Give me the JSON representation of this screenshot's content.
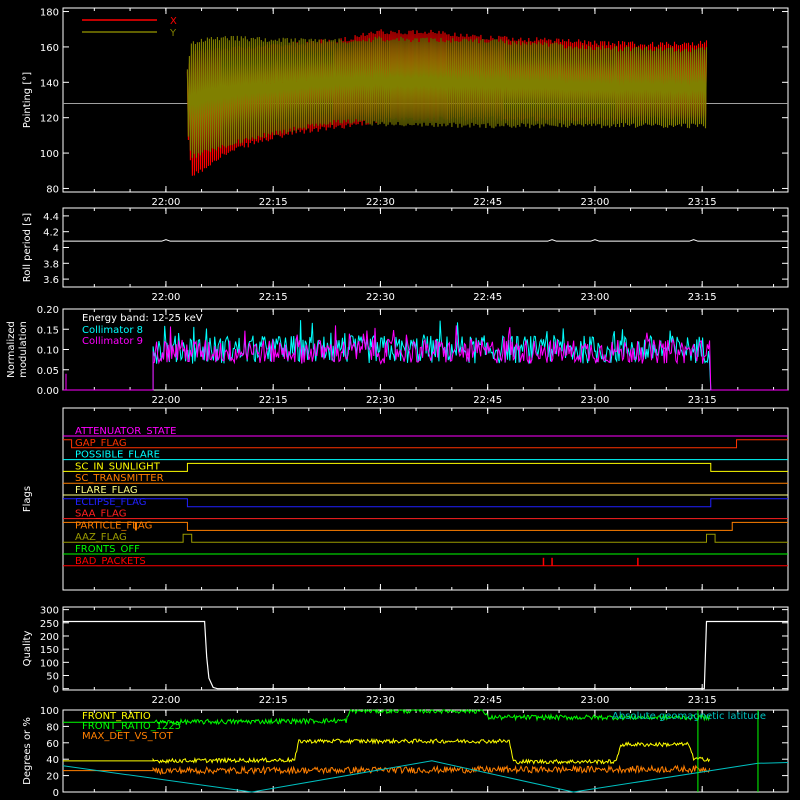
{
  "chart_data": [
    {
      "id": "pointing",
      "type": "line",
      "ylabel": "Pointing [°]",
      "ylim": [
        78,
        182
      ],
      "yticks": [
        80,
        100,
        120,
        140,
        160,
        180
      ],
      "xticks": [
        "22:00",
        "22:15",
        "22:30",
        "22:45",
        "23:00",
        "23:15"
      ],
      "reference_line": 128,
      "legend_position": "top-left",
      "series": [
        {
          "name": "X",
          "color": "#ff0000",
          "upper": [
            [
              22.05,
              148
            ],
            [
              22.06,
              158
            ],
            [
              22.1,
              160
            ],
            [
              22.2,
              161
            ],
            [
              22.3,
              163
            ],
            [
              22.42,
              166
            ],
            [
              22.5,
              170
            ],
            [
              22.6,
              170
            ],
            [
              22.75,
              167
            ],
            [
              22.9,
              165
            ],
            [
              23.0,
              164
            ],
            [
              23.1,
              163
            ],
            [
              23.2,
              163
            ],
            [
              23.26,
              164
            ]
          ],
          "lower": [
            [
              22.05,
              110
            ],
            [
              22.06,
              86
            ],
            [
              22.08,
              88
            ],
            [
              22.12,
              96
            ],
            [
              22.2,
              104
            ],
            [
              22.3,
              110
            ],
            [
              22.42,
              114
            ],
            [
              22.5,
              117
            ],
            [
              22.75,
              118
            ],
            [
              23.0,
              118
            ],
            [
              23.1,
              118
            ],
            [
              23.26,
              118
            ]
          ]
        },
        {
          "name": "Y",
          "color": "#808000",
          "upper": [
            [
              22.05,
              148
            ],
            [
              22.06,
              163
            ],
            [
              22.1,
              167
            ],
            [
              22.2,
              166
            ],
            [
              22.3,
              165
            ],
            [
              22.42,
              165
            ],
            [
              22.5,
              166
            ],
            [
              22.75,
              165
            ],
            [
              23.0,
              161
            ],
            [
              23.1,
              160
            ],
            [
              23.26,
              160
            ]
          ],
          "lower": [
            [
              22.05,
              110
            ],
            [
              22.06,
              96
            ],
            [
              22.1,
              100
            ],
            [
              22.2,
              107
            ],
            [
              22.3,
              112
            ],
            [
              22.42,
              117
            ],
            [
              22.5,
              115
            ],
            [
              22.75,
              114
            ],
            [
              23.0,
              114
            ],
            [
              23.1,
              114
            ],
            [
              23.26,
              114
            ]
          ]
        }
      ]
    },
    {
      "id": "roll",
      "type": "line",
      "ylabel": "Roll period [s]",
      "ylim": [
        3.5,
        4.5
      ],
      "yticks": [
        3.6,
        3.8,
        4.0,
        4.2,
        4.4
      ],
      "xticks": [
        "22:00",
        "22:15",
        "22:30",
        "22:45",
        "23:00",
        "23:15"
      ],
      "series": [
        {
          "color": "#ffffff",
          "value": 4.08
        }
      ]
    },
    {
      "id": "modulation",
      "type": "line",
      "ylabel": "Normalized modulation",
      "ylim": [
        0,
        0.2
      ],
      "yticks": [
        "0.00",
        "0.05",
        "0.10",
        "0.15",
        "0.20"
      ],
      "xticks": [
        "22:00",
        "22:15",
        "22:30",
        "22:45",
        "23:00",
        "23:15"
      ],
      "annotation": "Energy band: 12-25 keV",
      "series": [
        {
          "name": "Collimator 8",
          "color": "#00ffff",
          "start": 21.97,
          "end": 23.27,
          "level": 0.1,
          "spread": 0.035
        },
        {
          "name": "Collimator 9",
          "color": "#ff00ff",
          "start": 21.97,
          "end": 23.27,
          "level": 0.095,
          "spread": 0.03
        }
      ]
    },
    {
      "id": "flags",
      "type": "line",
      "ylabel": "Flags",
      "xticks": [
        "22:00",
        "22:15",
        "22:30",
        "22:45",
        "23:00",
        "23:15"
      ],
      "series": [
        {
          "name": "ATTENUATOR_STATE",
          "color": "#ff00ff",
          "segments": [
            [
              21.76,
              0
            ]
          ]
        },
        {
          "name": "GAP_FLAG",
          "color": "#ff3300",
          "segments": [
            [
              21.76,
              1
            ],
            [
              21.78,
              0
            ],
            [
              23.33,
              1
            ]
          ]
        },
        {
          "name": "POSSIBLE_FLARE",
          "color": "#00ffff",
          "segments": [
            [
              21.76,
              0
            ]
          ]
        },
        {
          "name": "SC_IN_SUNLIGHT",
          "color": "#ffff00",
          "segments": [
            [
              21.76,
              0
            ],
            [
              22.05,
              1
            ],
            [
              23.27,
              0
            ]
          ]
        },
        {
          "name": "SC_TRANSMITTER",
          "color": "#ff7f00",
          "segments": [
            [
              21.76,
              0
            ]
          ]
        },
        {
          "name": "FLARE_FLAG",
          "color": "#ffff80",
          "segments": [
            [
              21.76,
              0
            ]
          ]
        },
        {
          "name": "ECLIPSE_FLAG",
          "color": "#2020ff",
          "segments": [
            [
              21.76,
              1
            ],
            [
              22.05,
              0
            ],
            [
              23.27,
              1
            ]
          ]
        },
        {
          "name": "SAA_FLAG",
          "color": "#ff2020",
          "segments": [
            [
              21.76,
              0
            ]
          ]
        },
        {
          "name": "PARTICLE_FLAG",
          "color": "#ff7f00",
          "segments": [
            [
              21.76,
              1
            ],
            [
              22.05,
              0
            ],
            [
              23.32,
              1
            ]
          ]
        },
        {
          "name": "AAZ_FLAG",
          "color": "#9b9b00",
          "segments": [
            [
              21.76,
              0
            ],
            [
              22.04,
              1
            ],
            [
              22.06,
              0
            ],
            [
              23.26,
              1
            ],
            [
              23.28,
              0
            ]
          ]
        },
        {
          "name": "FRONTS_OFF",
          "color": "#00ff00",
          "segments": [
            [
              21.76,
              0
            ]
          ]
        },
        {
          "name": "BAD_PACKETS",
          "color": "#ff0000",
          "spikes": [
            22.88,
            22.9,
            23.1
          ]
        }
      ]
    },
    {
      "id": "quality",
      "type": "line",
      "ylabel": "Quality",
      "ylim": [
        -5,
        310
      ],
      "yticks": [
        0,
        50,
        100,
        150,
        200,
        250,
        300
      ],
      "xticks": [
        "22:00",
        "22:15",
        "22:30",
        "22:45",
        "23:00",
        "23:15"
      ],
      "series": [
        {
          "color": "#ffffff",
          "points": [
            [
              21.76,
              255
            ],
            [
              22.09,
              255
            ],
            [
              22.095,
              120
            ],
            [
              22.1,
              40
            ],
            [
              22.11,
              5
            ],
            [
              22.12,
              0
            ],
            [
              23.255,
              0
            ],
            [
              23.26,
              255
            ],
            [
              23.45,
              255
            ]
          ]
        }
      ]
    },
    {
      "id": "degrees",
      "type": "line",
      "ylabel": "Degrees or %",
      "ylim": [
        0,
        100
      ],
      "yticks": [
        0,
        20,
        40,
        60,
        80,
        100
      ],
      "xticks": [
        "22:00",
        "22:15",
        "22:30",
        "22:45",
        "23:00",
        "23:15"
      ],
      "series": [
        {
          "name": "FRONT_RATIO",
          "color": "#ffff00",
          "points": [
            [
              21.97,
              38
            ],
            [
              22.3,
              39
            ],
            [
              22.31,
              62
            ],
            [
              22.8,
              62
            ],
            [
              22.81,
              37
            ],
            [
              23.05,
              37
            ],
            [
              23.06,
              58
            ],
            [
              23.22,
              58
            ],
            [
              23.23,
              40
            ],
            [
              23.27,
              40
            ]
          ],
          "noise": 2.5
        },
        {
          "name": "FRONT_RATIO_1225",
          "color": "#00ff00",
          "points": [
            [
              21.97,
              85
            ],
            [
              22.42,
              87
            ],
            [
              22.43,
              99
            ],
            [
              22.74,
              99
            ],
            [
              22.75,
              91
            ],
            [
              23.27,
              91
            ]
          ],
          "noise": 3
        },
        {
          "name": "MAX_DET_VS_TOT",
          "color": "#ff7f00",
          "points": [
            [
              21.97,
              26
            ],
            [
              23.27,
              28
            ]
          ],
          "noise": 4
        },
        {
          "name": "Absolute geomagnetic latitude",
          "color": "#00c0c0",
          "points": [
            [
              21.76,
              32
            ],
            [
              22.2,
              0
            ],
            [
              22.62,
              38
            ],
            [
              22.95,
              0
            ],
            [
              23.38,
              35
            ],
            [
              23.45,
              36
            ]
          ],
          "noise": 0
        }
      ]
    }
  ]
}
